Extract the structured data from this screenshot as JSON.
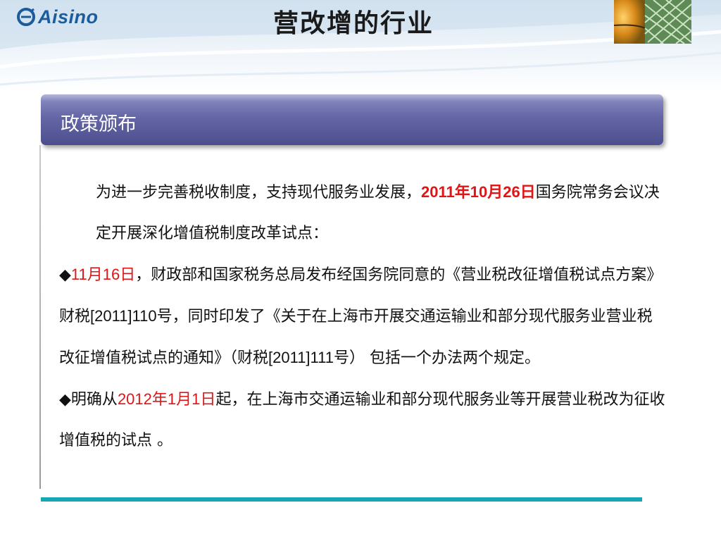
{
  "header": {
    "logo_text": "Aisino",
    "title": "营改增的行业"
  },
  "section": {
    "title": "政策颁布"
  },
  "body": {
    "p1": {
      "text_a": "为进一步完善税收制度，支持现代服务业发展，",
      "date": "2011年10月26日",
      "text_b": "国务院常务会议决定开展深化增值税制度改革试点："
    },
    "p2": {
      "bullet": "◆",
      "date_num1": "11",
      "date_unit1": "月",
      "date_num2": "16",
      "date_unit2": "日",
      "text_a": "，财政部和国家税务总局发布经国务院同意的《营业税改征增值税试点方案》财税",
      "doc_no1": "[2011]110",
      "text_b": "号，同时印发了《关于在上海市开展交通运输业和部分现代服务业营业税改征增值税试点的通知》（财税",
      "doc_no2": "[2011]111",
      "text_c": "号） 包括一个办法两个规定。"
    },
    "p3": {
      "bullet": "◆",
      "text_a": "明确从",
      "date_num1": "2012",
      "date_unit1": "年",
      "date_num2": "1",
      "date_unit2": "月",
      "date_num3": "1",
      "date_unit3": "日",
      "text_b": "起，在上海市交通运输业和部分现代服务业等开展营业税改为征收增值税的试点 。"
    }
  },
  "colors": {
    "accent_red": "#e01515",
    "section_bar": "#5c5e9e",
    "rule": "#17a6b3",
    "logo": "#1d5c9c"
  }
}
